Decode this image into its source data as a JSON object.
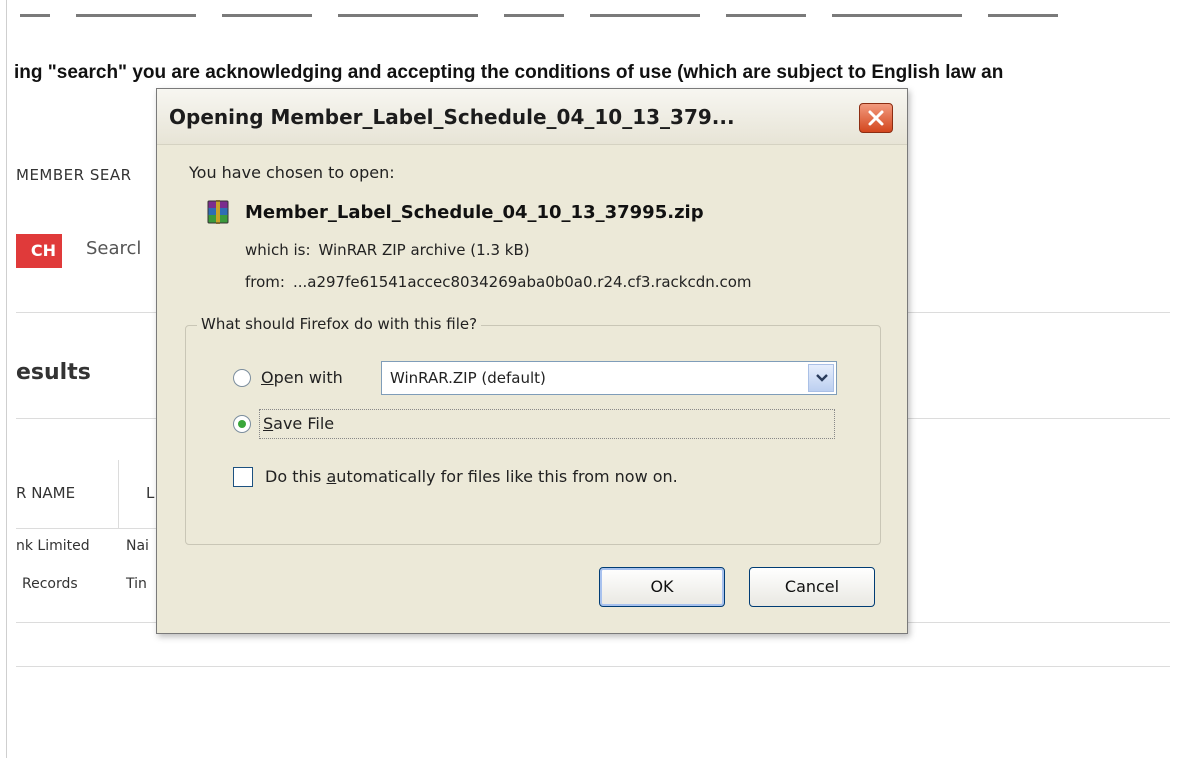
{
  "background": {
    "notice": "ing \"search\" you are acknowledging and accepting the conditions of use (which are subject to English law an",
    "member_search": "MEMBER SEAR",
    "search_button": "CH",
    "search_link": "Searcl",
    "results_heading": "esults",
    "columns": [
      "R NAME",
      "L"
    ],
    "rows": [
      [
        "nk Limited",
        "Nai"
      ],
      [
        "Records",
        "Tin"
      ]
    ]
  },
  "dialog": {
    "title": "Opening Member_Label_Schedule_04_10_13_379...",
    "intro": "You have chosen to open:",
    "file_name": "Member_Label_Schedule_04_10_13_37995.zip",
    "which_is_label": "which is:",
    "which_is_value": "WinRAR ZIP archive (1.3 kB)",
    "from_label": "from:",
    "from_value": "...a297fe61541accec8034269aba0b0a0.r24.cf3.rackcdn.com",
    "question": "What should Firefox do with this file?",
    "open_with": {
      "accel": "O",
      "rest": "pen with",
      "selected": false
    },
    "open_with_app": "WinRAR.ZIP (default)",
    "save_file": {
      "accel": "S",
      "rest": "ave File",
      "selected": true
    },
    "auto_checkbox": {
      "before": "Do this ",
      "accel": "a",
      "after": "utomatically for files like this from now on.",
      "checked": false
    },
    "ok_label": "OK",
    "cancel_label": "Cancel"
  }
}
